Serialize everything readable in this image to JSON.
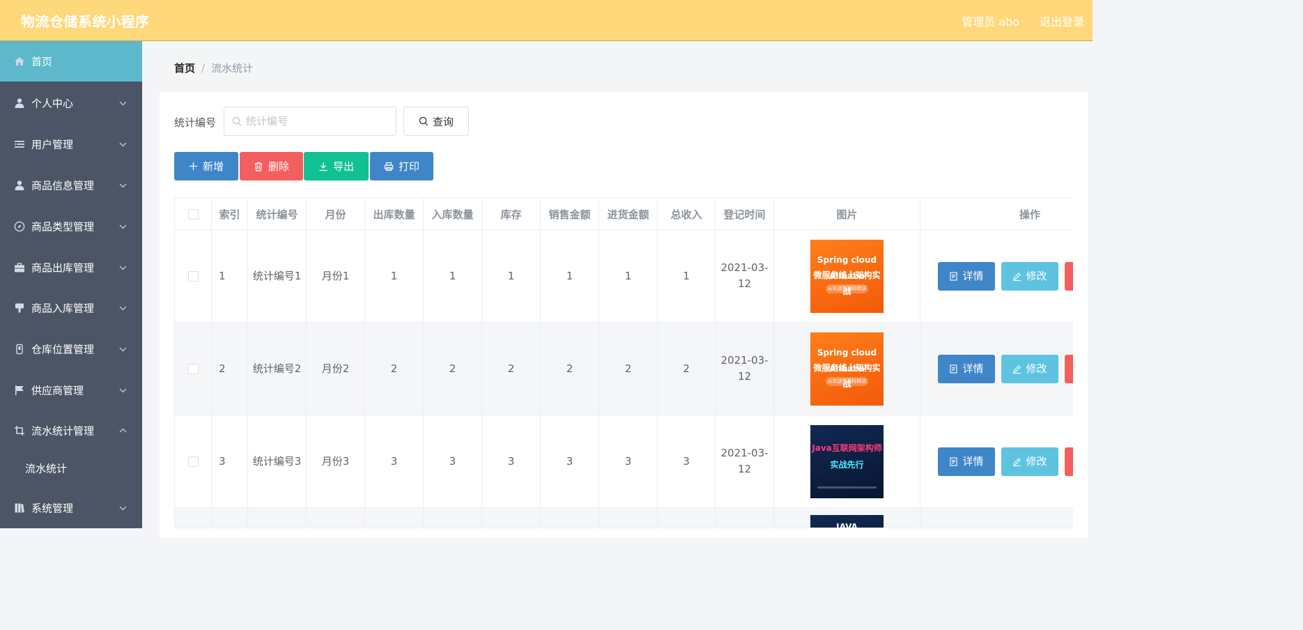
{
  "header": {
    "title": "物流仓储系统小程序",
    "admin": "管理员 abo",
    "logout": "退出登录"
  },
  "sidebar": {
    "items": [
      {
        "label": "首页",
        "icon": "home-icon"
      },
      {
        "label": "个人中心",
        "icon": "user-icon"
      },
      {
        "label": "用户管理",
        "icon": "list-icon"
      },
      {
        "label": "商品信息管理",
        "icon": "user-icon"
      },
      {
        "label": "商品类型管理",
        "icon": "compass-icon"
      },
      {
        "label": "商品出库管理",
        "icon": "briefcase-icon"
      },
      {
        "label": "商品入库管理",
        "icon": "stamp-icon"
      },
      {
        "label": "仓库位置管理",
        "icon": "device-icon"
      },
      {
        "label": "供应商管理",
        "icon": "flag-icon"
      },
      {
        "label": "流水统计管理",
        "icon": "crop-icon"
      },
      {
        "label": "系统管理",
        "icon": "book-icon"
      }
    ],
    "sub_item": "流水统计"
  },
  "breadcrumb": {
    "home": "首页",
    "separator": "/",
    "current": "流水统计"
  },
  "search": {
    "label": "统计编号",
    "placeholder": "统计编号",
    "button": "查询"
  },
  "toolbar": {
    "add": "新增",
    "delete": "删除",
    "export": "导出",
    "print": "打印"
  },
  "table": {
    "headers": [
      "索引",
      "统计编号",
      "月份",
      "出库数量",
      "入库数量",
      "库存",
      "销售金额",
      "进货金额",
      "总收入",
      "登记时间",
      "图片",
      "操作"
    ],
    "rows": [
      {
        "index": "1",
        "code": "统计编号1",
        "month": "月份1",
        "out": "1",
        "in": "1",
        "stock": "1",
        "sales": "1",
        "purchase": "1",
        "income": "1",
        "time": "2021-03-12",
        "img_l1": "Spring cloud Alibaba",
        "img_l2": "微服务线上架构实战",
        "img_l3": "从实战到源码精讲"
      },
      {
        "index": "2",
        "code": "统计编号2",
        "month": "月份2",
        "out": "2",
        "in": "2",
        "stock": "2",
        "sales": "2",
        "purchase": "2",
        "income": "2",
        "time": "2021-03-12",
        "img_l1": "Spring cloud Alibaba",
        "img_l2": "微服务线上架构实战",
        "img_l3": "从实战到源码精讲"
      },
      {
        "index": "3",
        "code": "统计编号3",
        "month": "月份3",
        "out": "3",
        "in": "3",
        "stock": "3",
        "sales": "3",
        "purchase": "3",
        "income": "3",
        "time": "2021-03-12",
        "img_l1": "Java互联网架构师",
        "img_l2": "实战先行",
        "img_l3": ""
      }
    ],
    "partial_row_img_text": "JAVA",
    "actions": {
      "detail": "详情",
      "edit": "修改"
    }
  },
  "colors": {
    "header": "#ffd87c",
    "sidebar": "#4b5565",
    "active": "#5eb8cc",
    "primary": "#3f86c8",
    "danger": "#f35f5f",
    "success": "#12c094",
    "info": "#5ec3e0"
  }
}
